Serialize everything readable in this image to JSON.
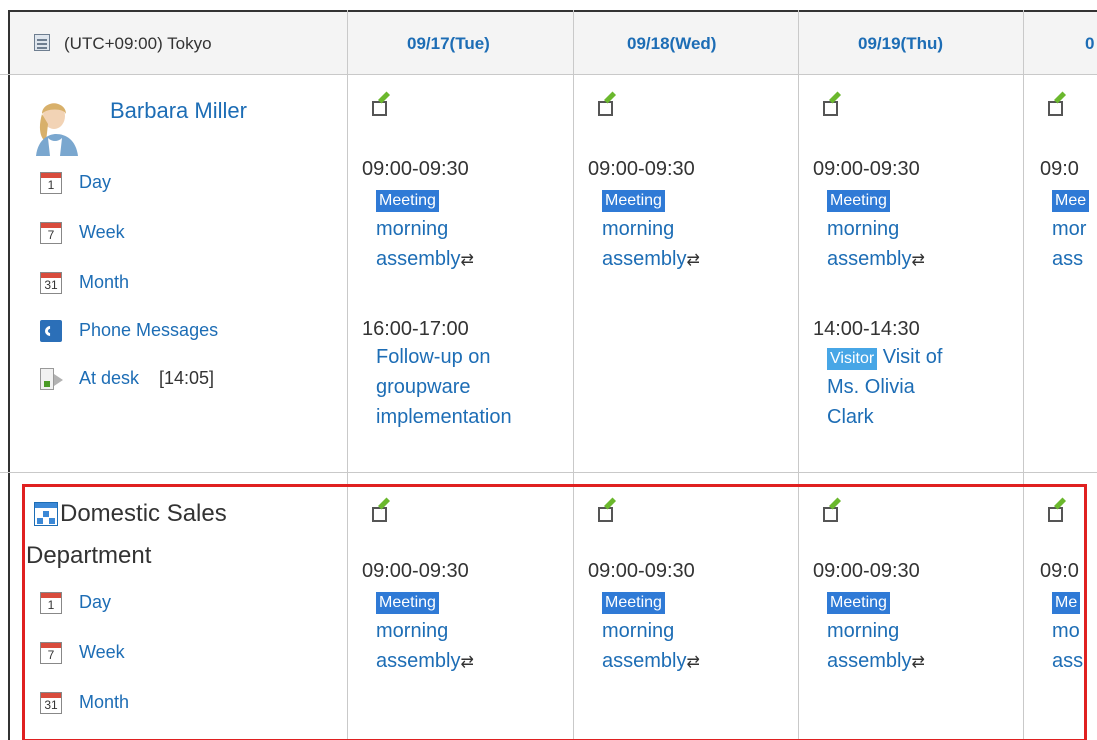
{
  "header": {
    "timezone_label": "(UTC+09:00) Tokyo",
    "dates": [
      "09/17(Tue)",
      "09/18(Wed)",
      "09/19(Thu)",
      "0"
    ]
  },
  "user": {
    "name": "Barbara Miller",
    "links": {
      "day": "Day",
      "week": "Week",
      "month": "Month",
      "phone": "Phone Messages",
      "status": "At desk",
      "status_time": "[14:05]"
    },
    "calendar_icon_numbers": {
      "day": "1",
      "week": "7",
      "month": "31"
    },
    "events": [
      [
        {
          "time": "09:00-09:30",
          "badge": "Meeting",
          "title_line1": "morning",
          "title_line2": "assembly",
          "repeat": "⇄"
        },
        {
          "time": "16:00-17:00",
          "title_line1": "Follow-up on",
          "title_line2": "groupware",
          "title_line3": "implementation"
        }
      ],
      [
        {
          "time": "09:00-09:30",
          "badge": "Meeting",
          "title_line1": "morning",
          "title_line2": "assembly",
          "repeat": "⇄"
        }
      ],
      [
        {
          "time": "09:00-09:30",
          "badge": "Meeting",
          "title_line1": "morning",
          "title_line2": "assembly",
          "repeat": "⇄"
        },
        {
          "time": "14:00-14:30",
          "badge": "Visitor",
          "title_line1": "Visit of",
          "title_line2": "Ms. Olivia",
          "title_line3": "Clark"
        }
      ],
      [
        {
          "time": "09:0",
          "badge": "Mee",
          "title_line1": "mor",
          "title_line2": "ass"
        }
      ]
    ]
  },
  "department": {
    "name_line1": "Domestic Sales",
    "name_line2": "Department",
    "links": {
      "day": "Day",
      "week": "Week",
      "month": "Month"
    },
    "events": [
      {
        "time": "09:00-09:30",
        "badge": "Meeting",
        "title_line1": "morning",
        "title_line2": "assembly",
        "repeat": "⇄"
      },
      {
        "time": "09:00-09:30",
        "badge": "Meeting",
        "title_line1": "morning",
        "title_line2": "assembly",
        "repeat": "⇄"
      },
      {
        "time": "09:00-09:30",
        "badge": "Meeting",
        "title_line1": "morning",
        "title_line2": "assembly",
        "repeat": "⇄"
      },
      {
        "time": "09:0",
        "badge": "Me",
        "title_line1": "mo",
        "title_line2": "ass"
      }
    ]
  },
  "colors": {
    "link": "#1d6db5",
    "meeting_badge": "#2f7ad6",
    "visitor_badge": "#47a6e6",
    "highlight_border": "#e02020"
  }
}
